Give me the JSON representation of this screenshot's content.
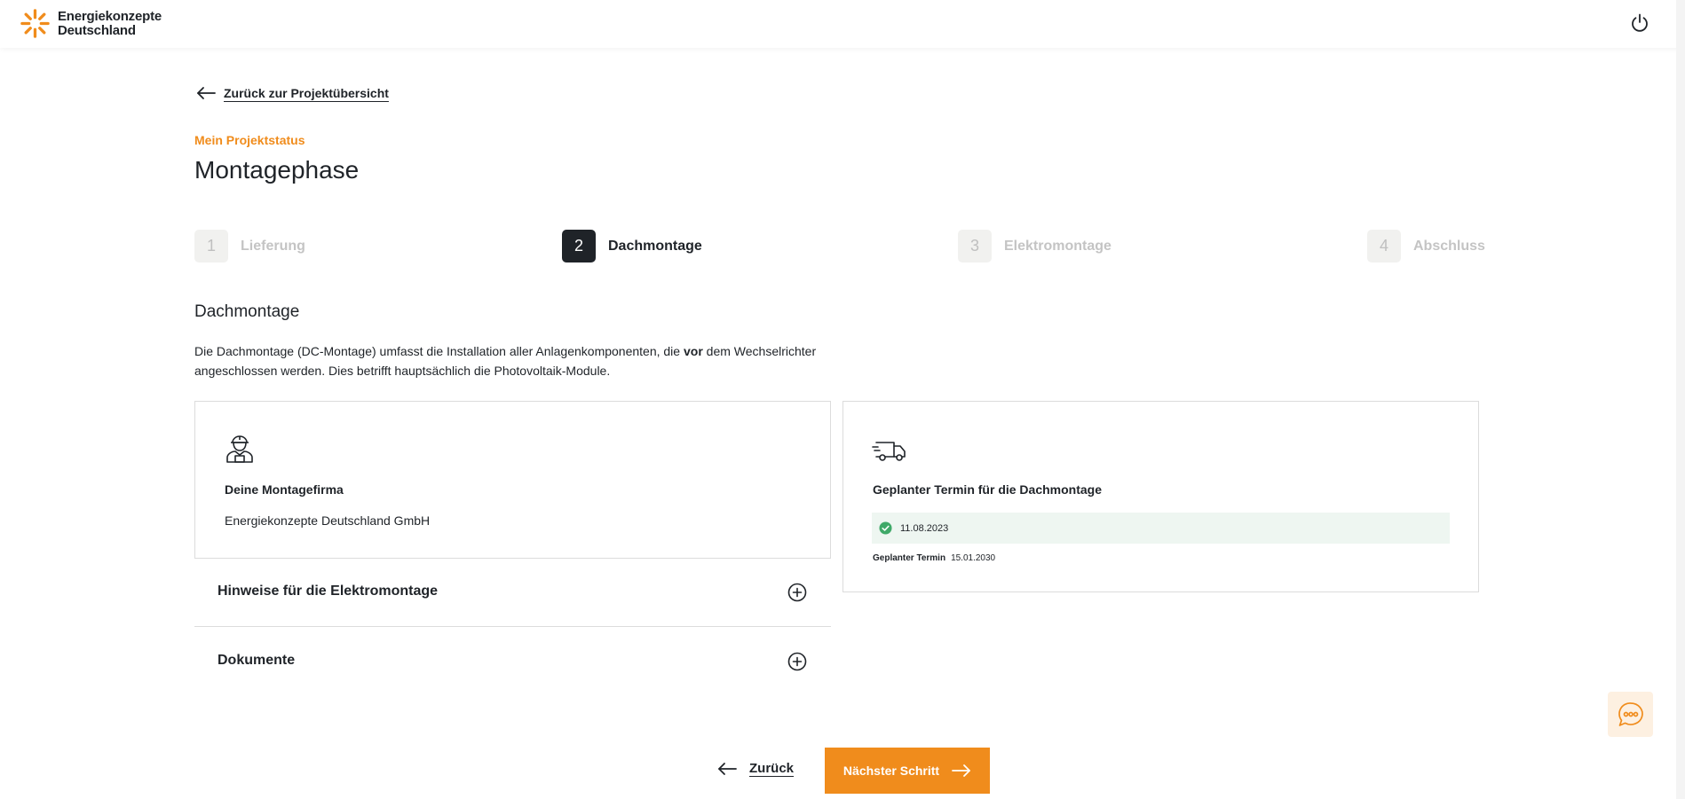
{
  "brand": {
    "name_line1": "Energiekonzepte",
    "name_line2": "Deutschland",
    "accent_color": "#f08c1c"
  },
  "header": {
    "power_icon": "power-icon"
  },
  "nav": {
    "back_label": "Zurück zur Projektübersicht"
  },
  "page": {
    "kicker": "Mein Projektstatus",
    "title": "Montagephase"
  },
  "steps": [
    {
      "number": "1",
      "label": "Lieferung",
      "state": "inactive"
    },
    {
      "number": "2",
      "label": "Dachmontage",
      "state": "active"
    },
    {
      "number": "3",
      "label": "Elektromontage",
      "state": "inactive"
    },
    {
      "number": "4",
      "label": "Abschluss",
      "state": "inactive"
    }
  ],
  "section": {
    "title": "Dachmontage",
    "desc_part1": "Die Dachmontage (DC-Montage) umfasst die Installation aller Anlagenkomponenten, die ",
    "desc_bold": "vor",
    "desc_part2": " dem Wechselrichter angeschlossen werden. Dies betrifft hauptsächlich die Photovoltaik-Module."
  },
  "company_card": {
    "icon": "worker-icon",
    "label": "Deine Montagefirma",
    "value": "Energiekonzepte Deutschland GmbH"
  },
  "schedule_card": {
    "icon": "delivery-van-icon",
    "label": "Geplanter Termin für die Dachmontage",
    "confirmed_date": "11.08.2023",
    "planned_label": "Geplanter Termin",
    "planned_date": "15.01.2030"
  },
  "accordions": [
    {
      "label": "Hinweise für die Elektromontage"
    },
    {
      "label": "Dokumente"
    }
  ],
  "footer": {
    "back_label": "Zurück",
    "next_label": "Nächster Schritt"
  }
}
